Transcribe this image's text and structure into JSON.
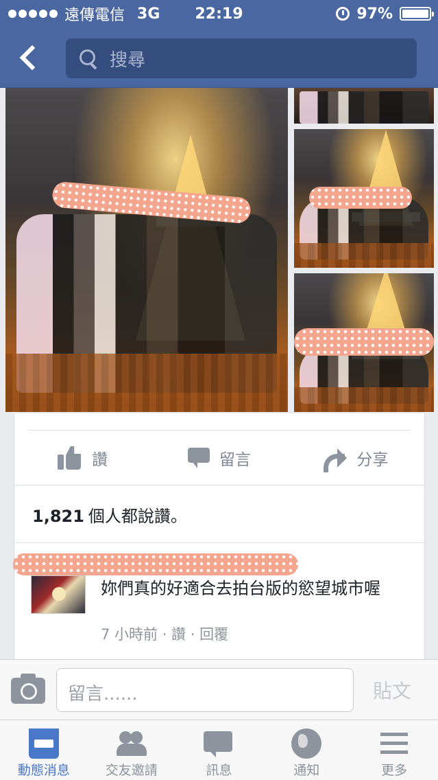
{
  "status_bar": {
    "carrier": "遠傳電信",
    "network": "3G",
    "time": "22:19",
    "battery": "97%"
  },
  "nav": {
    "search_placeholder": "搜尋"
  },
  "post": {
    "actions": {
      "like": "讚",
      "comment": "留言",
      "share": "分享"
    },
    "likes": {
      "count": "1,821",
      "text": "個人都說讚。"
    },
    "comment": {
      "text": "妳們真的好適合去拍台版的慾望城市喔",
      "meta": "7 小時前 · 讚 · 回覆"
    }
  },
  "composer": {
    "placeholder": "留言......",
    "post_label": "貼文"
  },
  "tabbar": {
    "items": [
      {
        "label": "動態消息",
        "icon": "news-feed-icon",
        "active": true
      },
      {
        "label": "交友邀請",
        "icon": "friend-requests-icon"
      },
      {
        "label": "訊息",
        "icon": "messages-icon"
      },
      {
        "label": "通知",
        "icon": "notifications-globe-icon"
      },
      {
        "label": "更多",
        "icon": "more-menu-icon"
      }
    ]
  },
  "colors": {
    "brand_blue": "#4b67a1",
    "active_tab": "#4a78c9",
    "privacy_blur": "#f3a58d"
  }
}
